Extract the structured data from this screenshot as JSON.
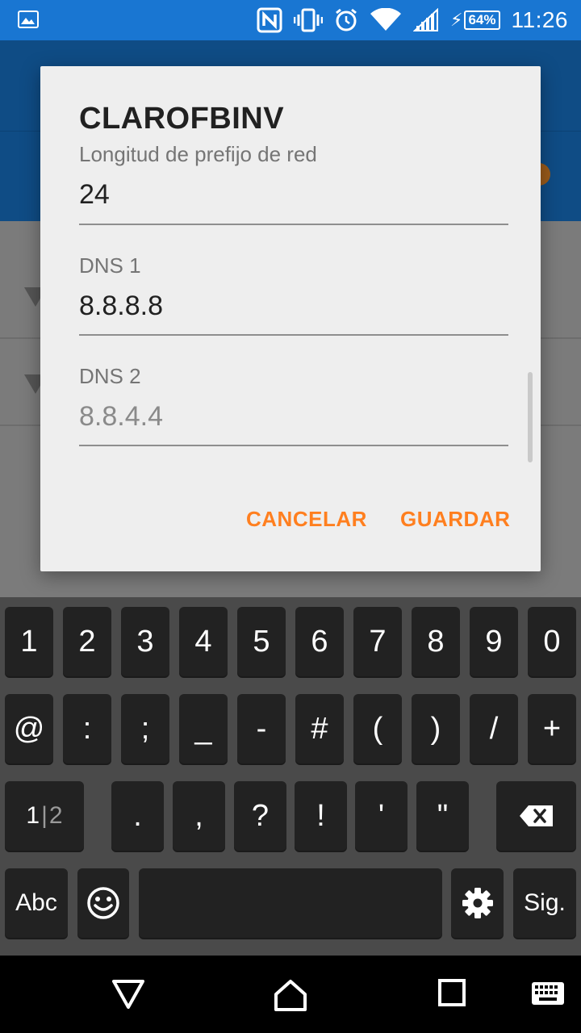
{
  "status_bar": {
    "battery_percent": "64%",
    "time": "11:26",
    "icons": [
      "gallery-icon",
      "nfc-icon",
      "vibrate-icon",
      "alarm-icon",
      "wifi-icon",
      "cellular-signal-icon",
      "charging-icon",
      "battery-icon"
    ]
  },
  "dialog": {
    "title": "CLAROFBINV",
    "fields": [
      {
        "label": "Longitud de prefijo de red",
        "value": "24"
      },
      {
        "label": "DNS 1",
        "value": "8.8.8.8"
      },
      {
        "label": "DNS 2",
        "placeholder": "8.8.4.4"
      }
    ],
    "cancel_label": "CANCELAR",
    "save_label": "GUARDAR",
    "accent_color": "#FF7F1F"
  },
  "keyboard": {
    "row1": [
      "1",
      "2",
      "3",
      "4",
      "5",
      "6",
      "7",
      "8",
      "9",
      "0"
    ],
    "row2": [
      "@",
      ":",
      ";",
      "_",
      "-",
      "#",
      "(",
      ")",
      "/",
      "+"
    ],
    "page_toggle": {
      "current": "1",
      "separator": "|",
      "next": "2"
    },
    "row3": [
      ".",
      ",",
      "?",
      "!",
      "'",
      "\""
    ],
    "abc_label": "Abc",
    "enter_label": "Sig.",
    "icons": [
      "backspace-icon",
      "emoji-icon",
      "settings-gear-icon"
    ]
  },
  "nav_bar": {
    "icons": [
      "back-icon",
      "home-icon",
      "recents-icon",
      "keyboard-switch-icon"
    ]
  }
}
